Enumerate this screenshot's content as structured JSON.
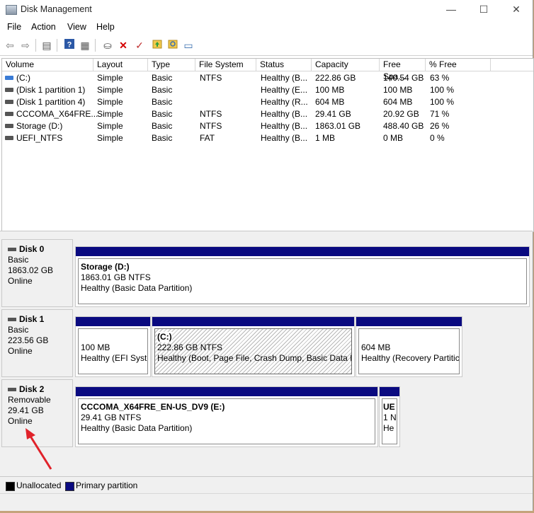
{
  "window": {
    "title": "Disk Management"
  },
  "controls": {
    "minimize": "—",
    "maximize": "☐",
    "close": "✕"
  },
  "menu": [
    "File",
    "Action",
    "View",
    "Help"
  ],
  "table": {
    "columns": [
      "Volume",
      "Layout",
      "Type",
      "File System",
      "Status",
      "Capacity",
      "Free Spa...",
      "% Free"
    ],
    "rows": [
      {
        "volume": "(C:)",
        "layout": "Simple",
        "type": "Basic",
        "fs": "NTFS",
        "status": "Healthy (B...",
        "capacity": "222.86 GB",
        "free": "140.54 GB",
        "pct": "63 %"
      },
      {
        "volume": "(Disk 1 partition 1)",
        "layout": "Simple",
        "type": "Basic",
        "fs": "",
        "status": "Healthy (E...",
        "capacity": "100 MB",
        "free": "100 MB",
        "pct": "100 %"
      },
      {
        "volume": "(Disk 1 partition 4)",
        "layout": "Simple",
        "type": "Basic",
        "fs": "",
        "status": "Healthy (R...",
        "capacity": "604 MB",
        "free": "604 MB",
        "pct": "100 %"
      },
      {
        "volume": "CCCOMA_X64FRE...",
        "layout": "Simple",
        "type": "Basic",
        "fs": "NTFS",
        "status": "Healthy (B...",
        "capacity": "29.41 GB",
        "free": "20.92 GB",
        "pct": "71 %"
      },
      {
        "volume": "Storage (D:)",
        "layout": "Simple",
        "type": "Basic",
        "fs": "NTFS",
        "status": "Healthy (B...",
        "capacity": "1863.01 GB",
        "free": "488.40 GB",
        "pct": "26 %"
      },
      {
        "volume": "UEFI_NTFS",
        "layout": "Simple",
        "type": "Basic",
        "fs": "FAT",
        "status": "Healthy (B...",
        "capacity": "1 MB",
        "free": "0 MB",
        "pct": "0 %"
      }
    ]
  },
  "disks": [
    {
      "name": "Disk 0",
      "kind": "Basic",
      "size": "1863.02 GB",
      "state": "Online",
      "partitions": [
        {
          "name": "Storage  (D:)",
          "detail": "1863.01 GB NTFS",
          "status": "Healthy (Basic Data Partition)"
        }
      ]
    },
    {
      "name": "Disk 1",
      "kind": "Basic",
      "size": "223.56 GB",
      "state": "Online",
      "partitions": [
        {
          "name": "",
          "detail": "100 MB",
          "status": "Healthy (EFI Syste"
        },
        {
          "name": "(C:)",
          "detail": "222.86 GB NTFS",
          "status": "Healthy (Boot, Page File, Crash Dump, Basic Data Pa"
        },
        {
          "name": "",
          "detail": "604 MB",
          "status": "Healthy (Recovery Partitic"
        }
      ]
    },
    {
      "name": "Disk 2",
      "kind": "Removable",
      "size": "29.41 GB",
      "state": "Online",
      "partitions": [
        {
          "name": "CCCOMA_X64FRE_EN-US_DV9  (E:)",
          "detail": "29.41 GB NTFS",
          "status": "Healthy (Basic Data Partition)"
        },
        {
          "name": "UE",
          "detail": "1 N",
          "status": "He"
        }
      ]
    }
  ],
  "legend": [
    {
      "label": "Unallocated",
      "color": "#000000"
    },
    {
      "label": "Primary partition",
      "color": "#0a0a80"
    }
  ],
  "annotation": {
    "arrow_color": "#e0222a"
  }
}
